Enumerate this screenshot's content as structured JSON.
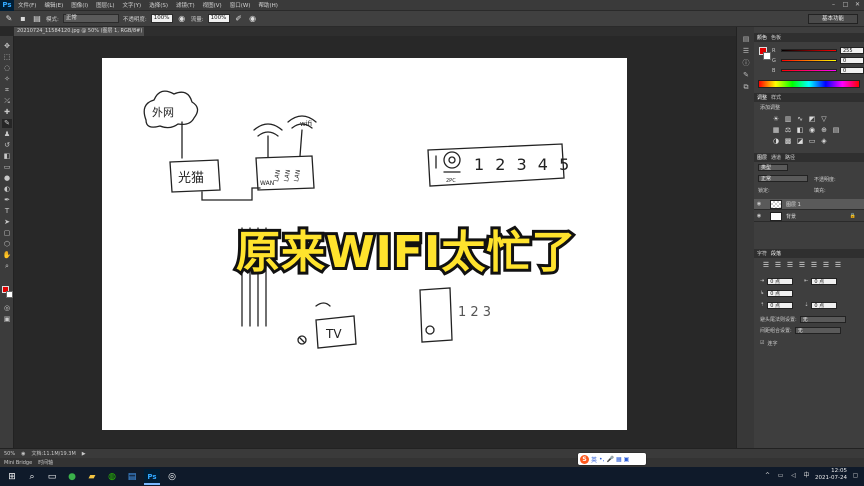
{
  "app": {
    "logo": "Ps",
    "menu": [
      "文件(F)",
      "编辑(E)",
      "图像(I)",
      "图层(L)",
      "文字(Y)",
      "选择(S)",
      "滤镜(T)",
      "视图(V)",
      "窗口(W)",
      "帮助(H)"
    ],
    "workspace": "基本功能"
  },
  "options_bar": {
    "mode_label": "模式:",
    "mode_value": "正常",
    "opacity_label": "不透明度:",
    "opacity_value": "100%",
    "flow_label": "流量:",
    "flow_value": "100%"
  },
  "document": {
    "tab_title": "20210724_115841​20.jpg @ 50% (图层 1, RGB/8#) *"
  },
  "sketch": {
    "labels": {
      "internet": "外网",
      "modem": "光猫",
      "wan": "WAN",
      "lan1": "LAN",
      "lan2": "LAN",
      "lan3": "LAN",
      "wifi_word": "wifi",
      "tv": "TV",
      "ports": "1 2 3 4 5",
      "cam_sub": "2PC",
      "phone_digits": "1 2 3"
    }
  },
  "overlay": {
    "text": "原来WIFI太忙了"
  },
  "status": {
    "zoom": "50%",
    "doc_info": "文档:11.1M/19.3M",
    "mini_bridge": "Mini Bridge",
    "timeline": "时间轴"
  },
  "panels": {
    "color_tabs": [
      "颜色",
      "色板"
    ],
    "channels": [
      {
        "label": "R",
        "value": "255",
        "color": "#ff0000"
      },
      {
        "label": "G",
        "value": "0",
        "color": "#ffcc00"
      },
      {
        "label": "B",
        "value": "0",
        "color": "#ff00ff"
      }
    ],
    "adjust_tabs": [
      "调整",
      "样式"
    ],
    "adjust_title": "添加调整",
    "layers_tabs": [
      "图层",
      "通道",
      "路径"
    ],
    "layers_kind": "类型",
    "blend_mode": "正常",
    "opacity_label": "不透明度:",
    "lock_label": "锁定:",
    "fill_label": "填充:",
    "layers": [
      {
        "name": "图层 1"
      },
      {
        "name": "背景"
      }
    ],
    "para_tabs": [
      "字符",
      "段落"
    ],
    "para_values": [
      "0 点",
      "0 点",
      "0 点",
      "0 点",
      "0 点"
    ],
    "hyphen_label": "避头尾法则设置:",
    "hyphen_value": "无",
    "spacing_label": "间距组合设置:",
    "spacing_value": "无",
    "hyphenate_label": "连字"
  },
  "taskbar": {
    "ps_label": "Ps",
    "time": "12:05",
    "date": "2021-07-24",
    "ime_label": "英"
  },
  "colors": {
    "overlay_fill": "#ffe32d",
    "overlay_stroke": "#111111",
    "foreground": "#e00000",
    "background": "#ffffff"
  }
}
